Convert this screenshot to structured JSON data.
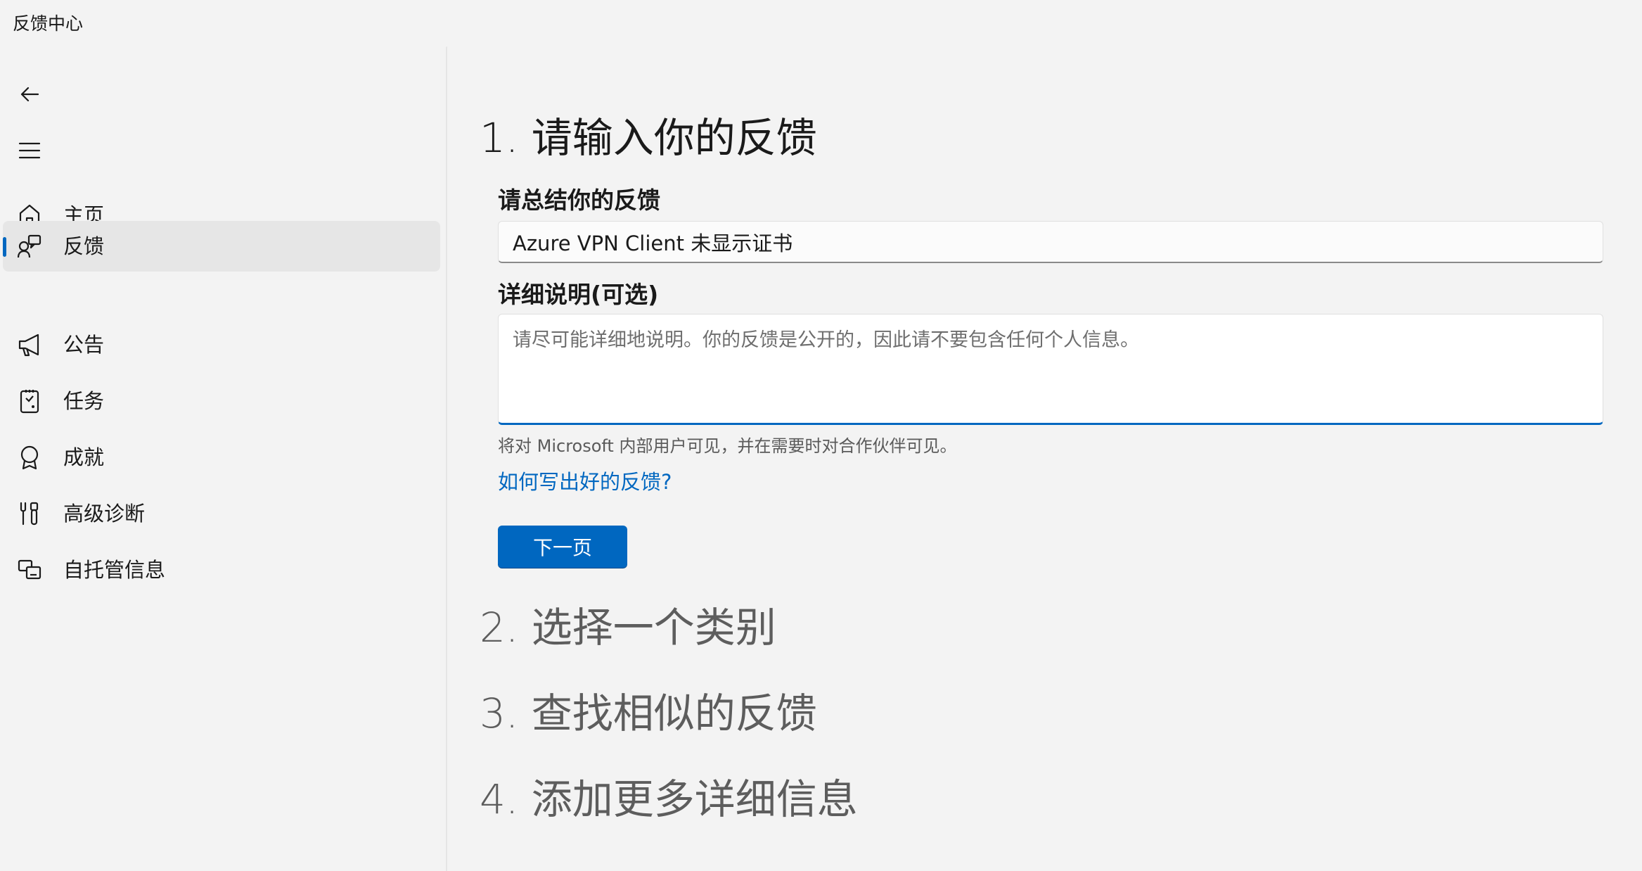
{
  "app": {
    "title": "反馈中心"
  },
  "sidebar": {
    "back_icon": "arrow-left-icon",
    "menu_icon": "hamburger-menu-icon",
    "items": [
      {
        "label": "主页",
        "icon": "home-icon",
        "active": false
      },
      {
        "label": "反馈",
        "icon": "feedback-icon",
        "active": true
      },
      {
        "label": "公告",
        "icon": "megaphone-icon",
        "active": false
      },
      {
        "label": "任务",
        "icon": "quest-icon",
        "active": false
      },
      {
        "label": "成就",
        "icon": "achievement-badge-icon",
        "active": false
      },
      {
        "label": "高级诊断",
        "icon": "wrench-screwdriver-icon",
        "active": false
      },
      {
        "label": "自托管信息",
        "icon": "devices-icon",
        "active": false
      }
    ]
  },
  "steps": [
    {
      "title": "1. 请输入你的反馈",
      "active": true
    },
    {
      "title": "2. 选择一个类别",
      "active": false
    },
    {
      "title": "3. 查找相似的反馈",
      "active": false
    },
    {
      "title": "4. 添加更多详细信息",
      "active": false
    }
  ],
  "form": {
    "summary_label": "请总结你的反馈",
    "summary_value": "Azure VPN Client 未显示证书",
    "details_label": "详细说明(可选)",
    "details_placeholder": "请尽可能详细地说明。你的反馈是公开的，因此请不要包含任何个人信息。",
    "details_value": "",
    "visibility_note": "将对 Microsoft 内部用户可见，并在需要时对合作伙伴可见。",
    "help_link": "如何写出好的反馈?",
    "next_button": "下一页"
  },
  "colors": {
    "accent": "#0067c0",
    "background": "#f3f3f3",
    "active_nav": "#e6e6e6"
  }
}
